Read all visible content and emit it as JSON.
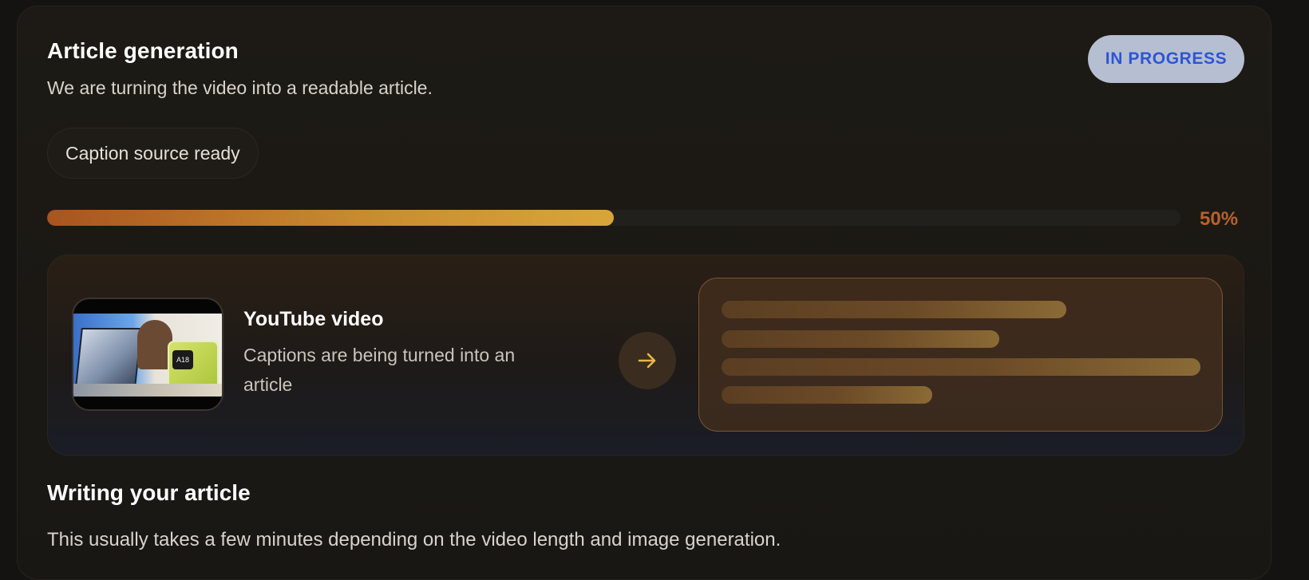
{
  "header": {
    "title": "Article generation",
    "subtitle": "We are turning the video into a readable article."
  },
  "status": {
    "label": "IN PROGRESS",
    "color": "#2e55d6",
    "background": "#b6bfd1"
  },
  "source_chip": {
    "label": "Caption source ready"
  },
  "progress": {
    "value": 0.5,
    "label": "50%",
    "accent": "#b8612a"
  },
  "conversion": {
    "video": {
      "title": "YouTube video",
      "description": "Captions are being turned into an article",
      "thumbnail_chip": "A18"
    },
    "arrow_icon": "arrow-right-icon",
    "preview_lines": [
      0.72,
      0.58,
      1.0,
      0.44
    ]
  },
  "writing": {
    "title": "Writing your article",
    "description": "This usually takes a few minutes depending on the video length and image generation."
  }
}
